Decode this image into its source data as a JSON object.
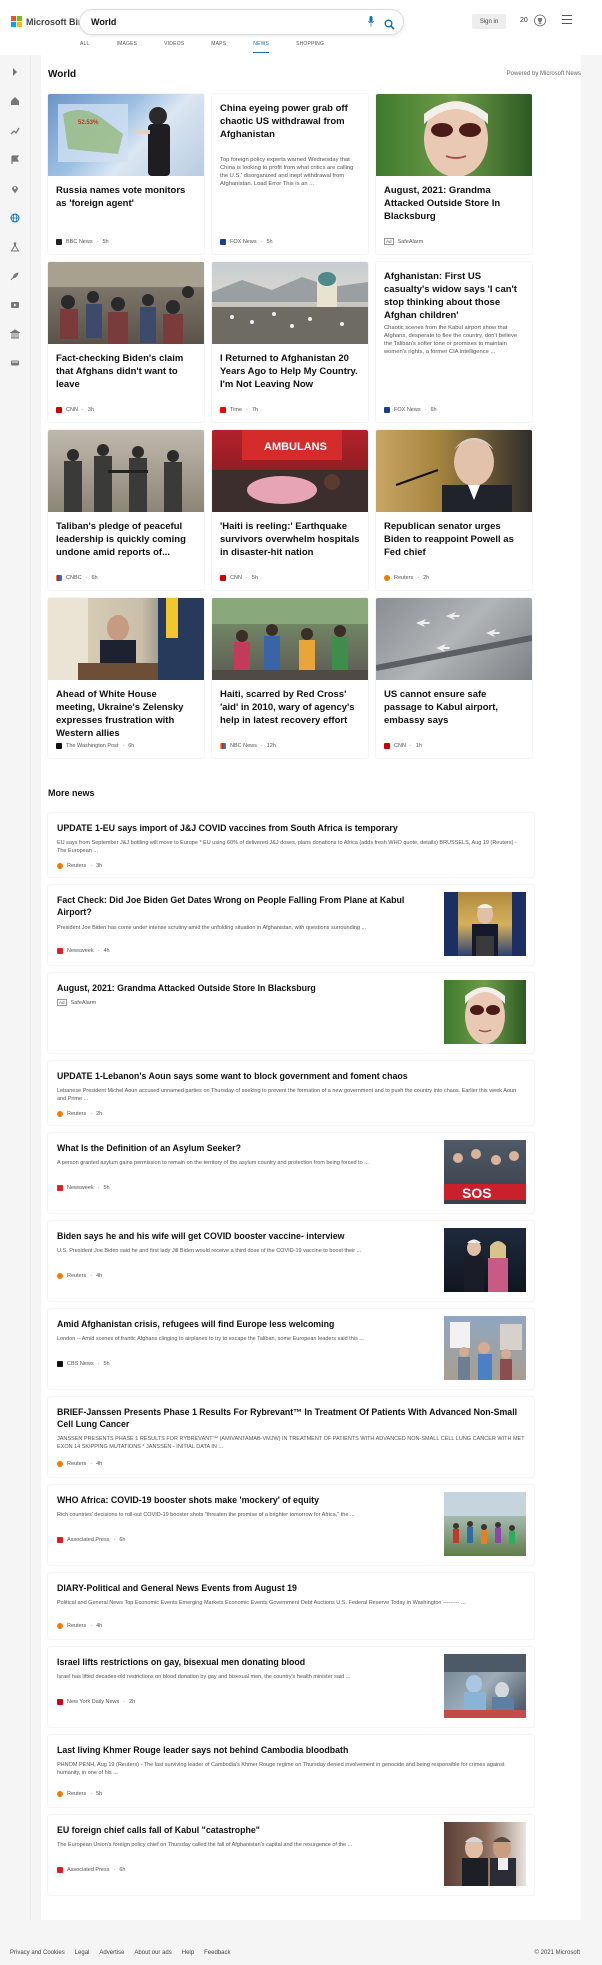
{
  "header": {
    "logo_text": "Microsoft Bing",
    "search_value": "World",
    "signin_label": "Sign in",
    "points": "20",
    "tabs": [
      "ALL",
      "IMAGES",
      "VIDEOS",
      "MAPS",
      "NEWS",
      "SHOPPING"
    ],
    "active_tab": "NEWS"
  },
  "world": {
    "title": "World",
    "powered": "Powered by Microsoft News",
    "cards": [
      {
        "title": "Russia names vote monitors as 'foreign agent'",
        "source": "BBC News",
        "time": "5h"
      },
      {
        "title": "China eyeing power grab off chaotic US withdrawal from Afghanistan",
        "snippet": "Top foreign policy experts warned Wednesday that China is looking to profit from what critics are calling the U.S.' disorganized and inept withdrawal from Afghanistan. Load Error This is an ...",
        "source": "FOX News",
        "time": "5h"
      },
      {
        "title": "August, 2021: Grandma Attacked Outside Store In Blacksburg",
        "ad": "Ad",
        "source": "SafeAlarm"
      },
      {
        "title": "Fact-checking Biden's claim that Afghans didn't want to leave",
        "source": "CNN",
        "time": "3h"
      },
      {
        "title": "I Returned to Afghanistan 20 Years Ago to Help My Country. I'm Not Leaving Now",
        "source": "Time",
        "time": "7h"
      },
      {
        "title": "Afghanistan: First US casualty's widow says 'I can't stop thinking about those Afghan children'",
        "snippet": "Chaotic scenes from the Kabul airport show that Afghans, desperate to flee the country, don't believe the Taliban's softer tone or promises to maintain women's rights, a former CIA intelligence ...",
        "source": "FOX News",
        "time": "6h"
      },
      {
        "title": "Taliban's pledge of peaceful leadership is quickly coming undone amid reports of...",
        "source": "CNBC",
        "time": "6h"
      },
      {
        "title": "'Haiti is reeling:' Earthquake survivors overwhelm hospitals in disaster-hit nation",
        "source": "CNN",
        "time": "5h"
      },
      {
        "title": "Republican senator urges Biden to reappoint Powell as Fed chief",
        "source": "Reuters",
        "time": "2h"
      },
      {
        "title": "Ahead of White House meeting, Ukraine's Zelensky expresses frustration with Western allies",
        "source": "The Washington Post",
        "time": "6h"
      },
      {
        "title": "Haiti, scarred by Red Cross' 'aid' in 2010, wary of agency's help in latest recovery effort",
        "source": "NBC News",
        "time": "12h"
      },
      {
        "title": "US cannot ensure safe passage to Kabul airport, embassy says",
        "source": "CNN",
        "time": "1h"
      }
    ]
  },
  "more_news": {
    "title": "More news",
    "items": [
      {
        "title": "UPDATE 1-EU says import of J&J COVID vaccines from South Africa is temporary",
        "snippet": "EU says from September J&J bottling will move to Europe * EU using 60% of delivered J&J doses, plans donations to Africa (adds fresh WHO quote, details) BRUSSELS, Aug 19 (Reuters) - The European ...",
        "source": "Reuters",
        "time": "3h"
      },
      {
        "title": "Fact Check: Did Joe Biden Get Dates Wrong on People Falling From Plane at Kabul Airport?",
        "snippet": "President Joe Biden has come under intense scrutiny amid the unfolding situation in Afghanistan, with questions surrounding ...",
        "source": "Newsweek",
        "time": "4h"
      },
      {
        "title": "August, 2021: Grandma Attacked Outside Store In Blacksburg",
        "ad": "Ad",
        "source": "SafeAlarm"
      },
      {
        "title": "UPDATE 1-Lebanon's Aoun says some want to block government and foment chaos",
        "snippet": "Lebanese President Michel Aoun accused unnamed parties on Thursday of seeking to prevent the formation of a new government and to push the country into chaos. Earlier this week Aoun and Prime ...",
        "source": "Reuters",
        "time": "2h"
      },
      {
        "title": "What Is the Definition of an Asylum Seeker?",
        "snippet": "A person granted asylum gains permission to remain on the territory of the asylum country and protection from being forced to ...",
        "source": "Newsweek",
        "time": "5h"
      },
      {
        "title": "Biden says he and his wife will get COVID booster vaccine- interview",
        "snippet": "U.S. President Joe Biden said he and first lady Jill Biden would receive a third dose of the COVID-19 vaccine to boost their ...",
        "source": "Reuters",
        "time": "4h"
      },
      {
        "title": "Amid Afghanistan crisis, refugees will find Europe less welcoming",
        "snippet": "London -- Amid scenes of frantic Afghans clinging to airplanes to try to escape the Taliban, some European leaders said this ...",
        "source": "CBS News",
        "time": "5h"
      },
      {
        "title": "BRIEF-Janssen Presents Phase 1 Results For Rybrevant™ In Treatment Of Patients With Advanced Non-Small Cell Lung Cancer",
        "snippet": "JANSSEN PRESENTS PHASE 1 RESULTS FOR RYBREVANT™ (AMIVANTAMAB-VMJW) IN TREATMENT OF PATIENTS WITH ADVANCED NON-SMALL CELL LUNG CANCER WITH MET EXON 14 SKIPPING MUTATIONS * JANSSEN - INITIAL DATA IN ...",
        "source": "Reuters",
        "time": "4h"
      },
      {
        "title": "WHO Africa: COVID-19 booster shots make 'mockery' of equity",
        "snippet": "Rich countries' decisions to roll-out COVID-19 booster shots \"threaten the promise of a brighter tomorrow for Africa,\" the ...",
        "source": "Associated Press",
        "time": "6h"
      },
      {
        "title": "DIARY-Political and General News Events from August 19",
        "snippet": "Political and General News Top Economic Events Emerging Markets Economic Events Government Debt Auctions U.S. Federal Reserve Today in Washington --------- ...",
        "source": "Reuters",
        "time": "4h"
      },
      {
        "title": "Israel lifts restrictions on gay, bisexual men donating blood",
        "snippet": "Israel has lifted decades-old restrictions on blood donation by gay and bisexual men, the country's health minister said ...",
        "source": "New York Daily News",
        "time": "2h"
      },
      {
        "title": "Last living Khmer Rouge leader says not behind Cambodia bloodbath",
        "snippet": "PHNOM PENH, Aug 19 (Reuters) - The last surviving leader of Cambodia's Khmer Rouge regime on Thursday denied involvement in genocide and being responsible for crimes against humanity, in one of his ...",
        "source": "Reuters",
        "time": "5h"
      },
      {
        "title": "EU foreign chief calls fall of Kabul \"catastrophe\"",
        "snippet": "The European Union's foreign policy chief on Thursday called the fall of Afghanistan's capital and the resurgence of the ...",
        "source": "Associated Press",
        "time": "6h"
      }
    ]
  },
  "footer": {
    "links": [
      "Privacy and Cookies",
      "Legal",
      "Advertise",
      "About our ads",
      "Help",
      "Feedback"
    ],
    "copyright": "© 2021 Microsoft"
  },
  "colors": {
    "accent": "#0b74b8"
  }
}
